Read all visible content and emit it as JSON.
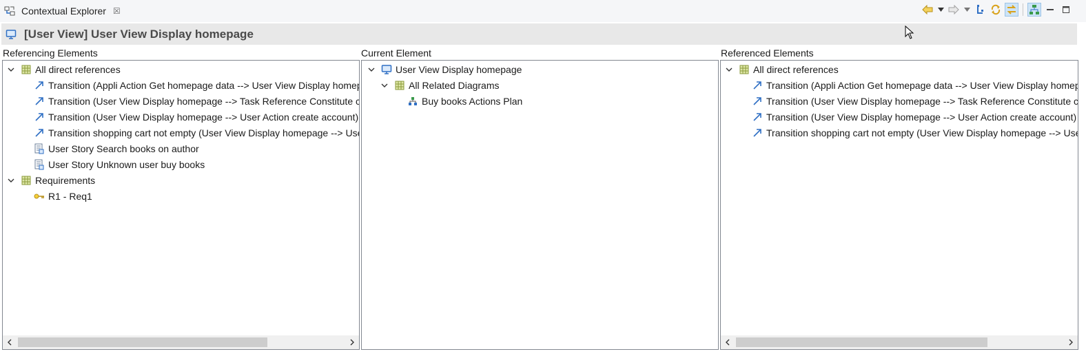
{
  "tab": {
    "title": "Contextual Explorer",
    "close": "☒"
  },
  "header": {
    "title": "[User View] User View Display homepage"
  },
  "referencing": {
    "label": "Referencing Elements",
    "group1": "All direct references",
    "items": [
      "Transition (Appli Action Get homepage data --> User View Display homepage)",
      "Transition (User View Display homepage --> Task Reference Constitute cart)",
      "Transition (User View Display homepage --> User Action create account)",
      "Transition shopping cart not empty (User View Display homepage --> User Action)",
      "User Story Search books on author",
      "User Story Unknown user buy books"
    ],
    "group2": "Requirements",
    "req": "R1 - Req1"
  },
  "current": {
    "label": "Current Element",
    "root": "User View Display homepage",
    "group": "All Related Diagrams",
    "diagram": "Buy books Actions Plan"
  },
  "referenced": {
    "label": "Referenced Elements",
    "group": "All direct references",
    "items": [
      "Transition (Appli Action Get homepage data --> User View Display homepage)",
      "Transition (User View Display homepage --> Task Reference Constitute cart)",
      "Transition (User View Display homepage --> User Action create account)",
      "Transition shopping cart not empty (User View Display homepage --> User Action)"
    ]
  },
  "colors": {
    "accent": "#2f6fc4",
    "folder": "#8a9a3a",
    "key": "#d4a514",
    "header_bg": "#e8e8e8"
  },
  "icons": [
    "back-arrow-icon",
    "forward-arrow-icon",
    "link-icon",
    "sync-icon",
    "hierarchy-icon",
    "minimize-icon",
    "maximize-icon",
    "transition-arrow-icon",
    "user-story-icon",
    "key-icon",
    "display-icon",
    "package-icon",
    "diagram-icon"
  ]
}
